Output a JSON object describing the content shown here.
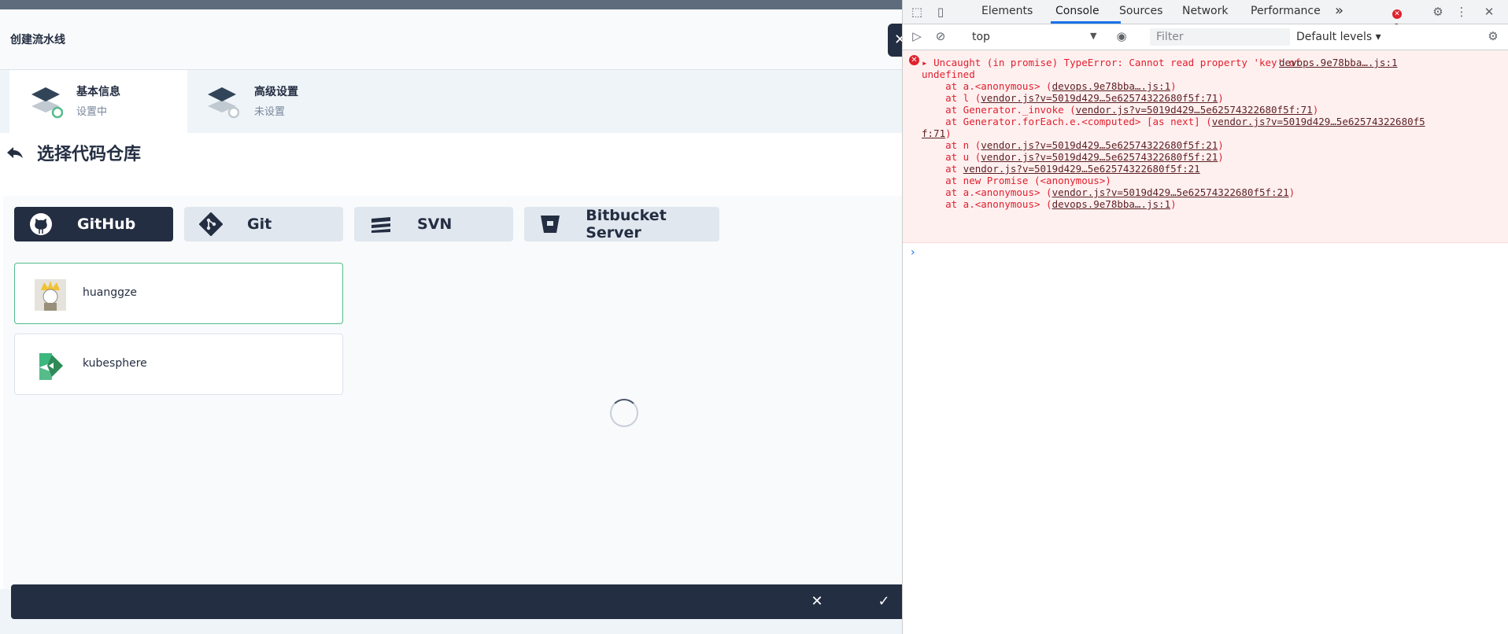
{
  "header": {
    "title": "创建流水线",
    "close_glyph": "✕"
  },
  "steps": [
    {
      "name": "基本信息",
      "status": "设置中",
      "state": "active"
    },
    {
      "name": "高级设置",
      "status": "未设置",
      "state": "inactive"
    }
  ],
  "section": {
    "title": "选择代码仓库"
  },
  "repo_tabs": [
    {
      "label": "GitHub",
      "icon": "github-icon",
      "active": true
    },
    {
      "label": "Git",
      "icon": "git-icon",
      "active": false
    },
    {
      "label": "SVN",
      "icon": "svn-icon",
      "active": false
    },
    {
      "label": "Bitbucket Server",
      "icon": "bitbucket-icon",
      "active": false
    }
  ],
  "accounts": [
    {
      "label": "huanggze",
      "icon": "user-avatar",
      "selected": true
    },
    {
      "label": "kubesphere",
      "icon": "kubesphere-logo",
      "selected": false
    }
  ],
  "footer": {
    "cancel_glyph": "✕",
    "confirm_glyph": "✓"
  },
  "devtools": {
    "tabs": [
      "Elements",
      "Console",
      "Sources",
      "Network",
      "Performance"
    ],
    "active_tab": "Console",
    "more_glyph": "»",
    "error_count": "1",
    "context": "top",
    "filter_placeholder": "Filter",
    "levels": "Default levels",
    "error": {
      "message_1": "Uncaught (in promise) TypeError: Cannot read property 'key' of",
      "message_2": "undefined",
      "source": "devops.9e78bba….js:1",
      "stack": [
        {
          "prefix": "    at a.<anonymous> (",
          "link": "devops.9e78bba….js:1",
          "suffix": ")"
        },
        {
          "prefix": "    at l (",
          "link": "vendor.js?v=5019d429…5e62574322680f5f:71",
          "suffix": ")"
        },
        {
          "prefix": "    at Generator._invoke (",
          "link": "vendor.js?v=5019d429…5e62574322680f5f:71",
          "suffix": ")"
        },
        {
          "prefix": "    at Generator.forEach.e.<computed> [as next] (",
          "link": "vendor.js?v=5019d429…5e62574322680f5",
          "suffix": ""
        },
        {
          "prefix": "",
          "link": "f:71",
          "suffix": ")"
        },
        {
          "prefix": "    at n (",
          "link": "vendor.js?v=5019d429…5e62574322680f5f:21",
          "suffix": ")"
        },
        {
          "prefix": "    at u (",
          "link": "vendor.js?v=5019d429…5e62574322680f5f:21",
          "suffix": ")"
        },
        {
          "prefix": "    at ",
          "link": "vendor.js?v=5019d429…5e62574322680f5f:21",
          "suffix": ""
        },
        {
          "prefix": "    at new Promise (<anonymous>)",
          "link": "",
          "suffix": ""
        },
        {
          "prefix": "    at a.<anonymous> (",
          "link": "vendor.js?v=5019d429…5e62574322680f5f:21",
          "suffix": ")"
        },
        {
          "prefix": "    at a.<anonymous> (",
          "link": "devops.9e78bba….js:1",
          "suffix": ")"
        }
      ]
    },
    "prompt_glyph": "›"
  },
  "colors": {
    "accent_dark": "#242e42",
    "selected_border": "#55bc8a",
    "error_red": "#e0202d"
  }
}
